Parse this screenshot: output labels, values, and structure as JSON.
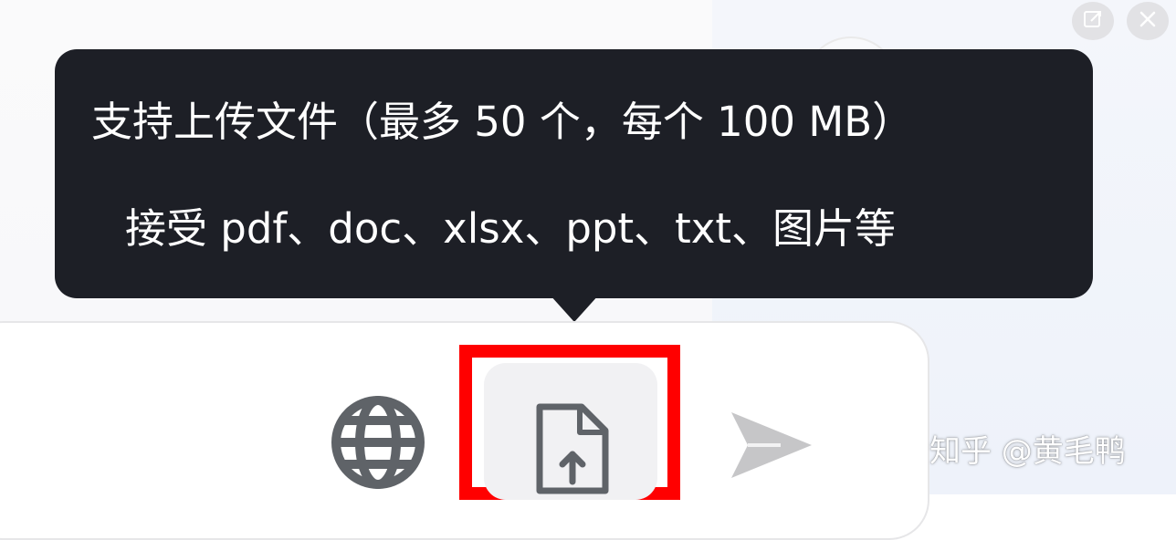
{
  "tooltip": {
    "line1": "支持上传文件（最多 50 个，每个 100 MB）",
    "line2": "接受 pdf、doc、xlsx、ppt、txt、图片等"
  },
  "icons": {
    "edit": "edit-window-icon",
    "close": "close-icon",
    "globe": "globe-icon",
    "upload": "file-upload-icon",
    "send": "send-icon"
  },
  "colors": {
    "tooltip_bg": "#1d1f26",
    "highlight_border": "#ff0000",
    "icon_gray": "#5f6368",
    "send_disabled": "#c6c6c8"
  },
  "watermark": "知乎 @黄毛鸭"
}
